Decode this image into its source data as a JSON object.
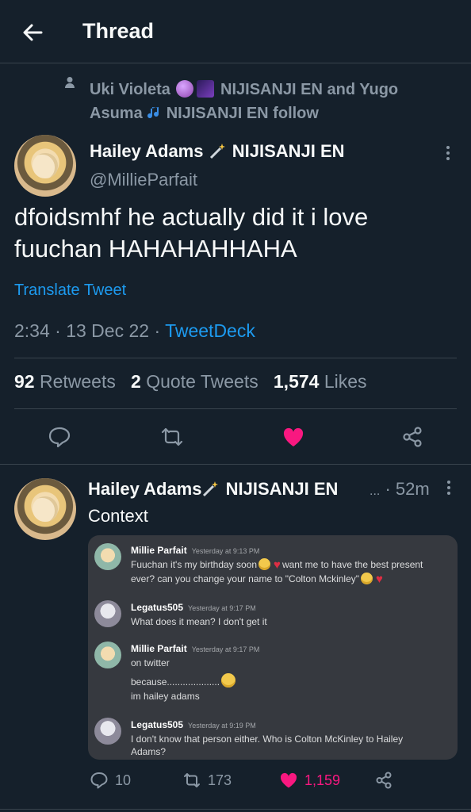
{
  "header": {
    "title": "Thread"
  },
  "social_context": {
    "text_line1": "Uki Violeta",
    "text_mid1": "NIJISANJI EN and Yugo",
    "text_line2": "Asuma",
    "text_mid2": "NIJISANJI EN follow"
  },
  "tweet": {
    "author_name": "Hailey Adams",
    "author_suffix": "NIJISANJI EN",
    "handle": "@MillieParfait",
    "text": "dfoidsmhf he actually did it i love fuuchan HAHAHAHHAHA",
    "translate": "Translate Tweet",
    "time": "2:34 · 13 Dec 22 · ",
    "source": "TweetDeck",
    "retweets": "92",
    "retweets_label": "Retweets",
    "quotes": "2",
    "quotes_label": "Quote Tweets",
    "likes": "1,574",
    "likes_label": "Likes"
  },
  "reply": {
    "author_name": "Hailey Adams",
    "author_suffix": "NIJISANJI EN",
    "ellipsis": "...",
    "time": "· 52m",
    "text": "Context",
    "replies": "10",
    "retweets": "173",
    "likes": "1,159"
  },
  "discord": [
    {
      "author": "Millie Parfait",
      "time": "Yesterday at 9:13 PM",
      "lines": [
        "Fuuchan it's my birthday soon",
        "want me to have the best present",
        "ever? can you change your name to \"Colton Mckinley\""
      ]
    },
    {
      "author": "Legatus505",
      "time": "Yesterday at 9:17 PM",
      "lines": [
        "What does it mean? I don't get it"
      ]
    },
    {
      "author": "Millie Parfait",
      "time": "Yesterday at 9:17 PM",
      "lines": [
        "on twitter",
        "because....................",
        "im hailey adams"
      ]
    },
    {
      "author": "Legatus505",
      "time": "Yesterday at 9:19 PM",
      "lines": [
        "I don't know that person either. Who is Colton McKinley to Hailey",
        "Adams?"
      ]
    }
  ],
  "colors": {
    "background": "#15202b",
    "accent": "#1d9bf0",
    "like": "#f91880",
    "muted": "#8b98a5"
  }
}
